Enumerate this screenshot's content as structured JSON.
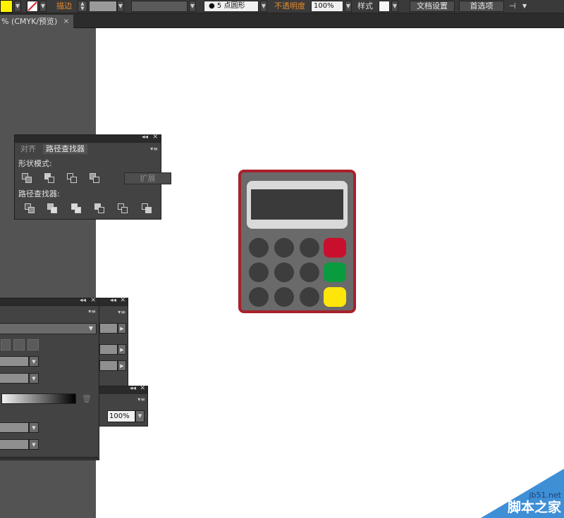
{
  "control_bar": {
    "stroke_label": "描边",
    "brush_label": "5 点圆形",
    "opacity_label": "不透明度",
    "opacity_value": "100%",
    "style_label": "样式",
    "doc_setup_button": "文档设置",
    "preferences_button": "首选项"
  },
  "document_tab": {
    "title": "% (CMYK/预览)",
    "close": "×"
  },
  "pathfinder_panel": {
    "tabs": [
      "对齐",
      "路径查找器"
    ],
    "shape_modes_label": "形状模式:",
    "pathfinders_label": "路径查找器:",
    "expand_button": "扩展"
  },
  "transparency_panel": {
    "opacity_value": "100%"
  },
  "watermark": {
    "site": "jb51.net",
    "name": "脚本之家"
  },
  "colors": {
    "fill": "#fff200",
    "calculator_border": "#a8202a",
    "calculator_body": "#6a6a6a",
    "key_dark": "#3d3d3d",
    "key_red": "#c8102e",
    "key_green": "#0a9b3f",
    "key_yellow": "#ffe60a"
  }
}
